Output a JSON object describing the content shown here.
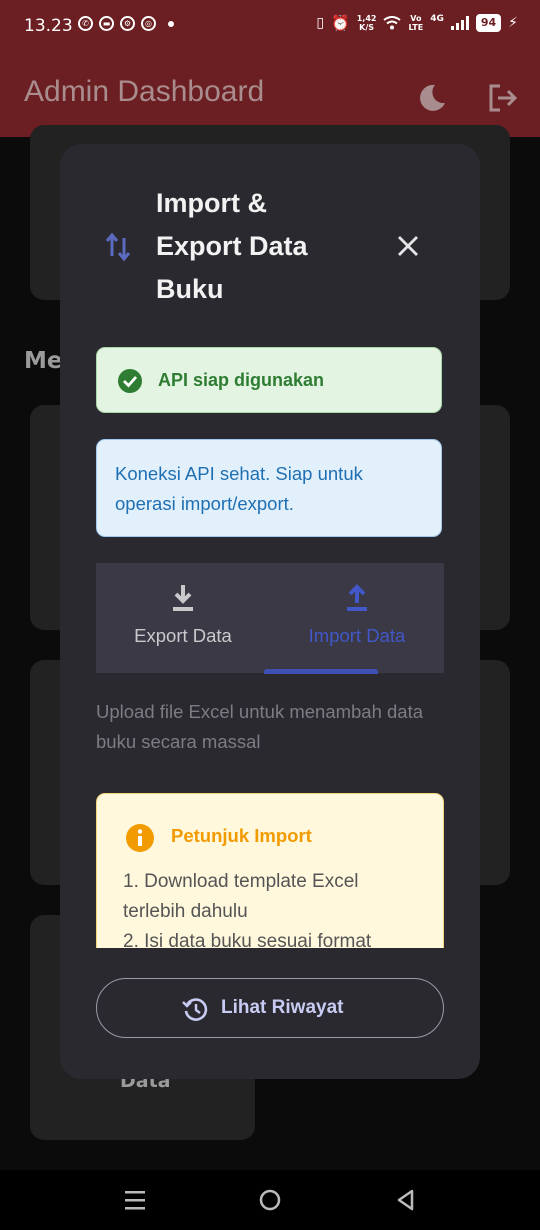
{
  "status_bar": {
    "time": "13.23",
    "net_speed_value": "1,42",
    "net_speed_unit": "K/S",
    "volte_top": "Vo",
    "volte_bottom": "LTE",
    "network": "4G",
    "battery": "94"
  },
  "app_bar": {
    "title": "Admin Dashboard",
    "theme_icon": "moon-icon",
    "logout_icon": "logout-icon"
  },
  "background": {
    "section_heading_partial": "Me",
    "card_label_partial": "Data"
  },
  "dialog": {
    "title": "Import & Export Data Buku",
    "title_icon": "swap-vertical-icon",
    "close_icon": "close-icon",
    "status_message": "API siap digunakan",
    "info_message": "Koneksi API sehat. Siap untuk operasi import/export.",
    "tabs": [
      {
        "label": "Export Data",
        "icon": "download-icon",
        "active": false
      },
      {
        "label": "Import Data",
        "icon": "upload-icon",
        "active": true
      }
    ],
    "description": "Upload file Excel untuk menambah data buku secara massal",
    "guide": {
      "title": "Petunjuk Import",
      "step1": "1. Download template Excel terlebih dahulu",
      "step2": "2. Isi data buku sesuai format"
    },
    "history_button": "Lihat Riwayat"
  },
  "colors": {
    "app_bar": "#6b1f22",
    "dialog_bg": "#2a2930",
    "accent": "#3f51b5",
    "success": "#2e7d32",
    "info": "#1f6fb3",
    "warning": "#f29b00"
  }
}
